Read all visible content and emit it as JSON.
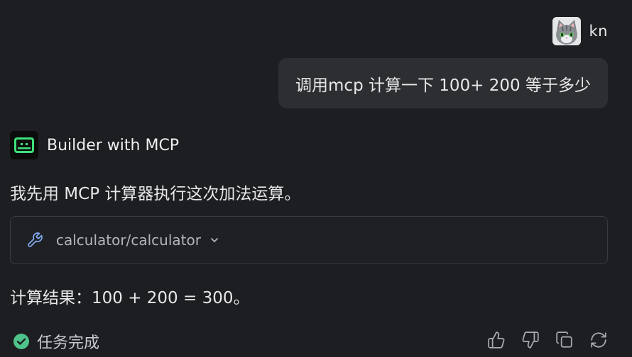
{
  "user": {
    "name": "kn",
    "message": "调用mcp 计算一下 100+ 200 等于多少"
  },
  "bot": {
    "name": "Builder with MCP",
    "intro": "我先用 MCP 计算器执行这次加法运算。",
    "tool_call": {
      "name": "calculator/calculator",
      "icon": "wrench-icon"
    },
    "result": "计算结果：100 + 200 = 300。"
  },
  "footer": {
    "status_text": "任务完成",
    "status_color": "#4ec38a",
    "actions": [
      "thumbs-up-icon",
      "thumbs-down-icon",
      "copy-icon",
      "refresh-icon"
    ]
  },
  "colors": {
    "background": "#1d1e21",
    "bubble": "#2d2e31",
    "bot_accent": "#3ee07a",
    "tool_icon": "#7da7ea"
  }
}
